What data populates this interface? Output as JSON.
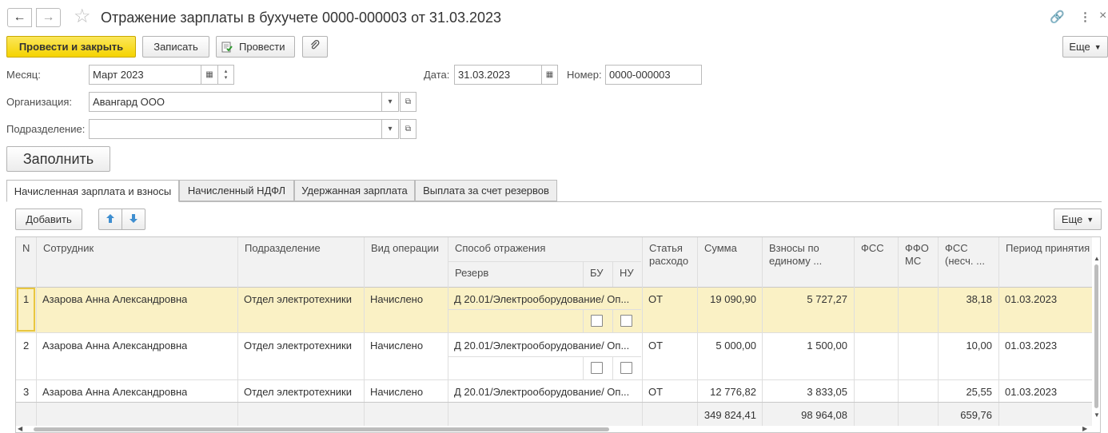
{
  "window": {
    "title": "Отражение зарплаты в бухучете 0000-000003 от 31.03.2023",
    "back_icon": "←",
    "forward_icon": "→",
    "favorite_icon": "☆",
    "link_icon": "🔗",
    "menu_icon": "⋮",
    "close_icon": "×"
  },
  "toolbar": {
    "post_close": "Провести и закрыть",
    "save": "Записать",
    "post": "Провести",
    "attach_icon": "📎",
    "more": "Еще"
  },
  "form": {
    "month_label": "Месяц:",
    "month_value": "Март 2023",
    "date_label": "Дата:",
    "date_value": "31.03.2023",
    "number_label": "Номер:",
    "number_value": "0000-000003",
    "org_label": "Организация:",
    "org_value": "Авангард ООО",
    "dept_label": "Подразделение:",
    "dept_value": "",
    "fill_button": "Заполнить"
  },
  "tabs": [
    {
      "label": "Начисленная зарплата и взносы",
      "active": true
    },
    {
      "label": "Начисленный НДФЛ",
      "active": false
    },
    {
      "label": "Удержанная зарплата",
      "active": false
    },
    {
      "label": "Выплата за счет резервов",
      "active": false
    }
  ],
  "table_toolbar": {
    "add": "Добавить",
    "up_icon": "🡅",
    "down_icon": "🡇",
    "more": "Еще"
  },
  "table": {
    "headers": {
      "n": "N",
      "employee": "Сотрудник",
      "department": "Подразделение",
      "operation": "Вид операции",
      "method": "Способ отражения",
      "reserve": "Резерв",
      "bu": "БУ",
      "nu": "НУ",
      "expense_line1": "Статья",
      "expense_line2": "расходо",
      "sum": "Сумма",
      "contrib_line1": "Взносы по",
      "contrib_line2": "единому ...",
      "fss": "ФСС",
      "ffoms_line1": "ФФО",
      "ffoms_line2": "МС",
      "fss_ns_line1": "ФСС",
      "fss_ns_line2": "(несч. ...",
      "period": "Период принятия"
    },
    "rows": [
      {
        "n": "1",
        "employee": "Азарова Анна Александровна",
        "department": "Отдел электротехники",
        "operation": "Начислено",
        "method": "Д 20.01/Электрооборудование/ Оп...",
        "expense": "ОТ",
        "sum": "19 090,90",
        "contrib": "5 727,27",
        "fss": "",
        "ffoms": "",
        "fss_ns": "38,18",
        "period": "01.03.2023"
      },
      {
        "n": "2",
        "employee": "Азарова Анна Александровна",
        "department": "Отдел электротехники",
        "operation": "Начислено",
        "method": "Д 20.01/Электрооборудование/ Оп...",
        "expense": "ОТ",
        "sum": "5 000,00",
        "contrib": "1 500,00",
        "fss": "",
        "ffoms": "",
        "fss_ns": "10,00",
        "period": "01.03.2023"
      },
      {
        "n": "3",
        "employee": "Азарова Анна Александровна",
        "department": "Отдел электротехники",
        "operation": "Начислено",
        "method": "Д 20.01/Электрооборудование/ Оп...",
        "expense": "ОТ",
        "sum": "12 776,82",
        "contrib": "3 833,05",
        "fss": "",
        "ffoms": "",
        "fss_ns": "25,55",
        "period": "01.03.2023"
      }
    ],
    "totals": {
      "sum": "349 824,41",
      "contrib": "98 964,08",
      "fss_ns": "659,76"
    }
  },
  "colors": {
    "primary_button": "#f5d300",
    "selected_row": "#faf1c5",
    "arrow_blue": "#3e8ed0"
  }
}
